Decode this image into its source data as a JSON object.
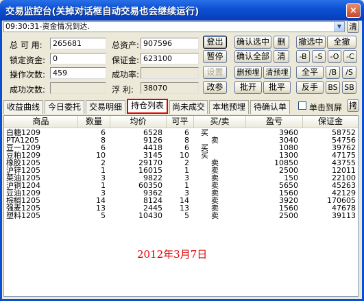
{
  "window": {
    "title": "交易监控台(关掉对话框自动交易也会继续运行)",
    "close_label": "×"
  },
  "status": {
    "message": "09:30:31-资金情况到达.",
    "arrow": "▼",
    "clear_label": "清"
  },
  "account": {
    "available_label": "总 可 用:",
    "available_value": "265681",
    "locked_label": "锁定资金:",
    "locked_value": "0",
    "ops_label": "操作次数:",
    "ops_value": "459",
    "success_label": "成功次数:",
    "success_value": "",
    "total_assets_label": "总资产:",
    "total_assets_value": "907596",
    "margin_label": "保证金:",
    "margin_value": "623100",
    "success_rate_label": "成功率:",
    "success_rate_value": "",
    "floating_label": "浮    利:",
    "floating_value": "38070"
  },
  "controls": {
    "login": "登出",
    "pause": "暂停",
    "settings": "设置",
    "change_params": "改参",
    "confirm_selected": "确认选中",
    "delete": "删",
    "confirm_all": "确认全部",
    "clear": "清",
    "delete_preorder": "删预埋",
    "clear_preorder": "清预埋",
    "batch_open": "批开",
    "batch_close": "批平",
    "cancel_selected": "撤选中",
    "cancel_all": "全撤",
    "minus_b": "-B",
    "minus_s": "-S",
    "minus_o": "-O",
    "minus_c": "-C",
    "close_all": "全平",
    "slash_b": "/B",
    "slash_s": "/S",
    "reverse": "反手",
    "bs": "BS",
    "sb": "SB"
  },
  "tabs": [
    {
      "label": "收益曲线"
    },
    {
      "label": "今日委托"
    },
    {
      "label": "交易明细"
    },
    {
      "label": "持仓列表"
    },
    {
      "label": "尚未成交"
    },
    {
      "label": "本地预埋"
    },
    {
      "label": "待确认单"
    }
  ],
  "single_click_label": "单击到屏",
  "expand_label": "拷",
  "table": {
    "columns": [
      "商品",
      "数量",
      "均价",
      "可平",
      "买/卖",
      "盈亏",
      "保证金"
    ],
    "rows": [
      [
        "白糖1209",
        "6",
        "6528",
        "6",
        "买",
        "3960",
        "58752"
      ],
      [
        "PTA1205",
        "8",
        "9126",
        "8",
        "卖",
        "3040",
        "54756"
      ],
      [
        "豆一1209",
        "6",
        "4418",
        "6",
        "买",
        "1080",
        "39762"
      ],
      [
        "豆粕1209",
        "10",
        "3145",
        "10",
        "买",
        "1300",
        "47175"
      ],
      [
        "橡胶1205",
        "2",
        "29170",
        "2",
        "卖",
        "10850",
        "43755"
      ],
      [
        "沪锌1205",
        "1",
        "16015",
        "1",
        "卖",
        "2500",
        "12011"
      ],
      [
        "菜油1205",
        "3",
        "9822",
        "3",
        "卖",
        "150",
        "22100"
      ],
      [
        "沪铜1204",
        "1",
        "60350",
        "1",
        "卖",
        "5650",
        "45263"
      ],
      [
        "豆油1209",
        "3",
        "9362",
        "3",
        "卖",
        "1560",
        "42129"
      ],
      [
        "棕榈1205",
        "14",
        "8124",
        "14",
        "卖",
        "3920",
        "170605"
      ],
      [
        "强麦1205",
        "13",
        "2445",
        "13",
        "卖",
        "1560",
        "47678"
      ],
      [
        "塑料1205",
        "5",
        "10430",
        "5",
        "卖",
        "2500",
        "39113"
      ]
    ]
  },
  "annotation": "2012年3月7日",
  "colors": {
    "titlebar": "#0a4fd1",
    "active_tab_border": "#e00000",
    "annotation": "#e00000"
  }
}
